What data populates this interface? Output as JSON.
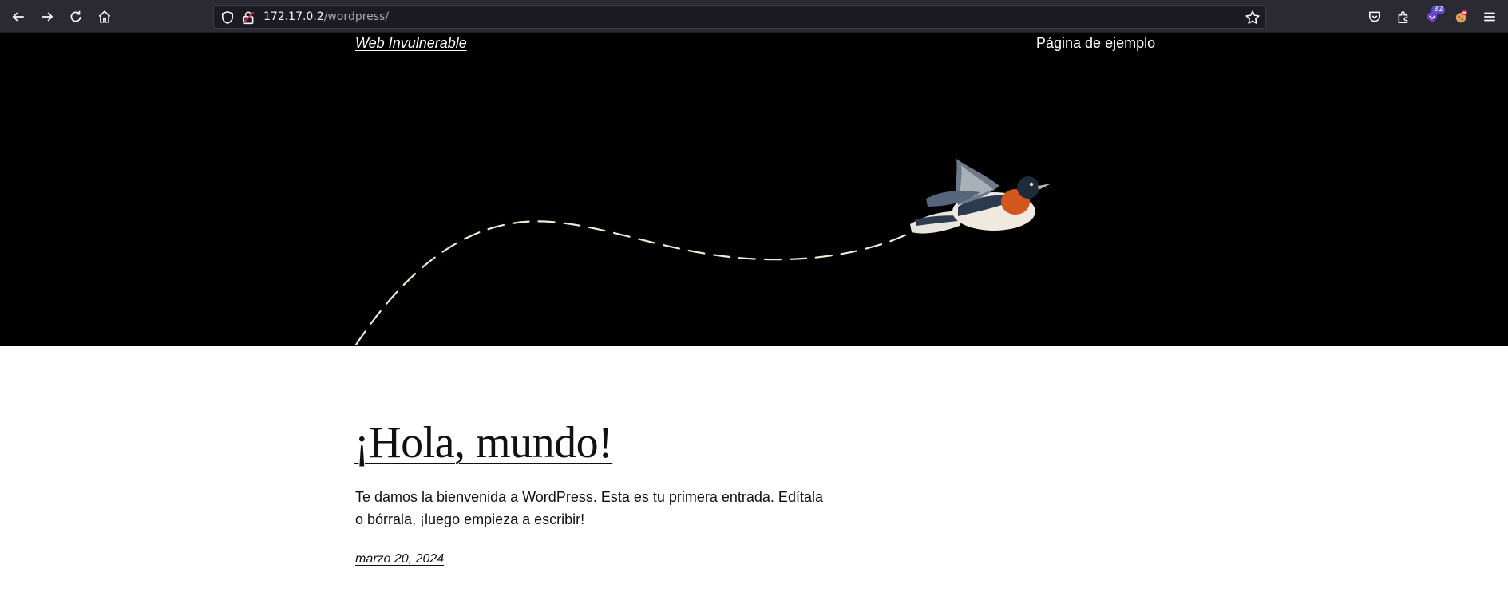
{
  "browser": {
    "url_host": "172.17.0.2",
    "url_path": "/wordpress/",
    "extension_badge": "32",
    "icons": [
      "back-icon",
      "forward-icon",
      "reload-icon",
      "home-icon",
      "shield-icon",
      "lock-icon",
      "star-icon",
      "pocket-icon",
      "extensions-icon",
      "shield-extension-icon",
      "cookie-extension-icon",
      "menu-icon"
    ]
  },
  "site": {
    "title": "Web Invulnerable",
    "nav_item": "Página de ejemplo"
  },
  "post": {
    "title": "¡Hola, mundo!",
    "excerpt": "Te damos la bienvenida a WordPress. Esta es tu primera entrada. Edítala o bórrala, ¡luego empieza a escribir!",
    "date": "marzo 20, 2024"
  },
  "colors": {
    "toolbar_bg": "#2b2a33",
    "hero_bg": "#000000",
    "dash_line": "#f3e9d2",
    "bird_breast": "#d2561e"
  }
}
